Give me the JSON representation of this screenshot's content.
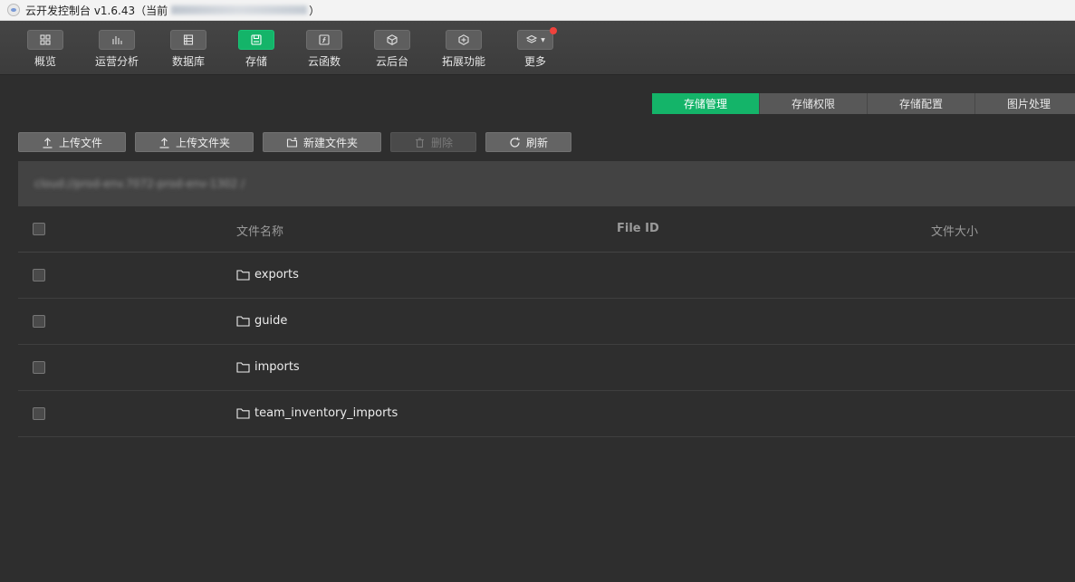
{
  "window": {
    "title": "云开发控制台 v1.6.43（当前",
    "title_suffix": "）"
  },
  "toolbar": {
    "items": [
      {
        "label": "概览",
        "icon": "grid-icon"
      },
      {
        "label": "运营分析",
        "icon": "bar-chart-icon"
      },
      {
        "label": "数据库",
        "icon": "database-icon"
      },
      {
        "label": "存储",
        "icon": "storage-icon",
        "active": true
      },
      {
        "label": "云函数",
        "icon": "function-icon"
      },
      {
        "label": "云后台",
        "icon": "cube-icon"
      },
      {
        "label": "拓展功能",
        "icon": "extension-icon"
      },
      {
        "label": "更多",
        "icon": "layers-icon",
        "badge": true
      }
    ]
  },
  "tabs": [
    {
      "label": "存储管理",
      "active": true
    },
    {
      "label": "存储权限"
    },
    {
      "label": "存储配置"
    },
    {
      "label": "图片处理"
    }
  ],
  "actions": {
    "upload_file": "上传文件",
    "upload_folder": "上传文件夹",
    "new_folder": "新建文件夹",
    "delete": "删除",
    "refresh": "刷新"
  },
  "path": {
    "text": "cloud://prod-env.7072-prod-env-1302 /"
  },
  "table": {
    "headers": {
      "name": "文件名称",
      "file_id": "File ID",
      "size": "文件大小"
    },
    "rows": [
      {
        "name": "exports"
      },
      {
        "name": "guide"
      },
      {
        "name": "imports"
      },
      {
        "name": "team_inventory_imports"
      }
    ]
  },
  "colors": {
    "accent": "#14b469",
    "background": "#2e2e2e",
    "badge": "#f0423c"
  }
}
